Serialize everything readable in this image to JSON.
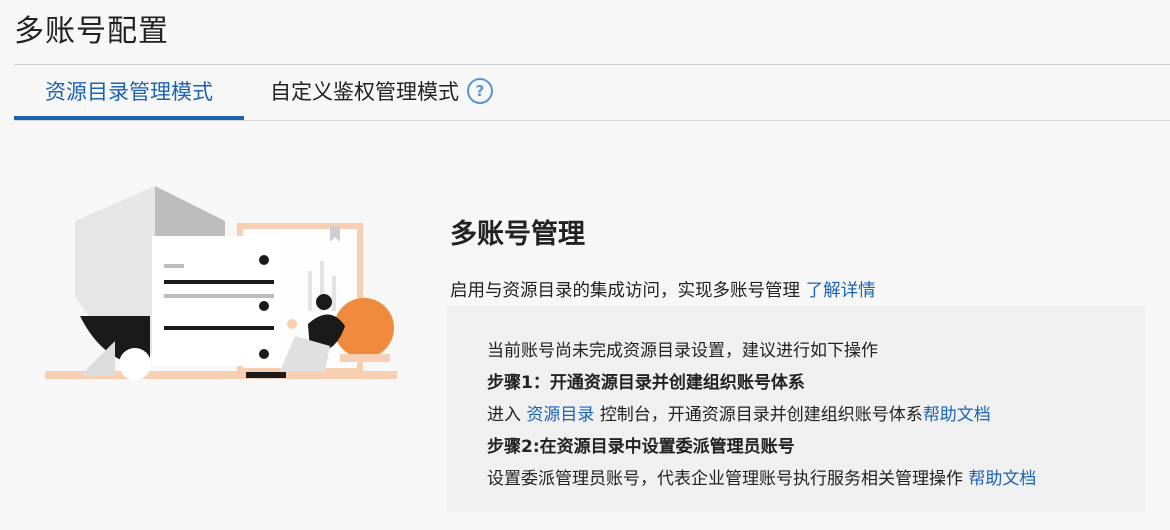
{
  "page": {
    "title": "多账号配置"
  },
  "tabs": [
    {
      "label": "资源目录管理模式",
      "active": true
    },
    {
      "label": "自定义鉴权管理模式",
      "active": false,
      "help_icon": "question-circle-icon"
    }
  ],
  "section": {
    "title": "多账号管理",
    "description": "启用与资源目录的集成访问，实现多账号管理",
    "learn_more": "了解详情"
  },
  "steps": {
    "intro": "当前账号尚未完成资源目录设置，建议进行如下操作",
    "step1_title": "步骤1：开通资源目录并创建组织账号体系",
    "step1_prefix": "进入",
    "step1_link": "资源目录",
    "step1_suffix": "控制台，开通资源目录并创建组织账号体系",
    "step1_help": "帮助文档",
    "step2_title": "步骤2:在资源目录中设置委派管理员账号",
    "step2_text": "设置委派管理员账号，代表企业管理账号执行服务相关管理操作",
    "step2_help": "帮助文档"
  },
  "colors": {
    "accent": "#1c63b3",
    "illustration_orange": "#f08a3c",
    "illustration_peach": "#f7cfb3"
  }
}
